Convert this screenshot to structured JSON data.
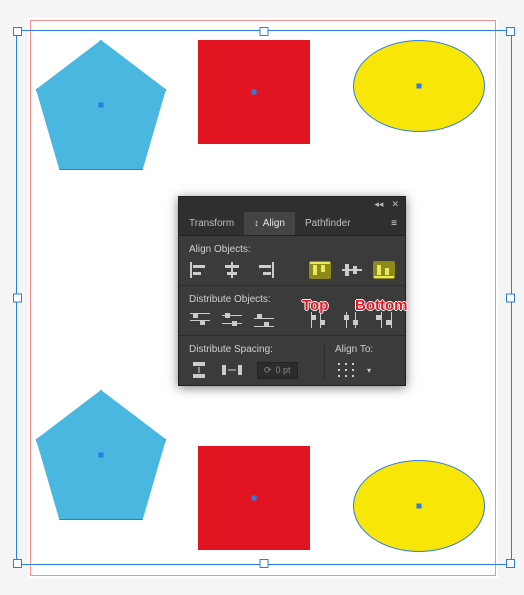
{
  "panel": {
    "tabs": {
      "transform": "Transform",
      "align": "Align",
      "pathfinder": "Pathfinder"
    },
    "sections": {
      "align_objects": "Align Objects:",
      "distribute_objects": "Distribute Objects:",
      "distribute_spacing": "Distribute Spacing:",
      "align_to": "Align To:"
    },
    "spacing_value": "0 pt"
  },
  "annotations": {
    "top": "Top",
    "bottom": "Bottom"
  },
  "colors": {
    "pentagon": "#49b7e0",
    "square": "#e31421",
    "ellipse": "#f7e608",
    "panel_bg": "#3b3b3b",
    "highlight": "#8b8a1a",
    "selection": "#2a7de1"
  }
}
